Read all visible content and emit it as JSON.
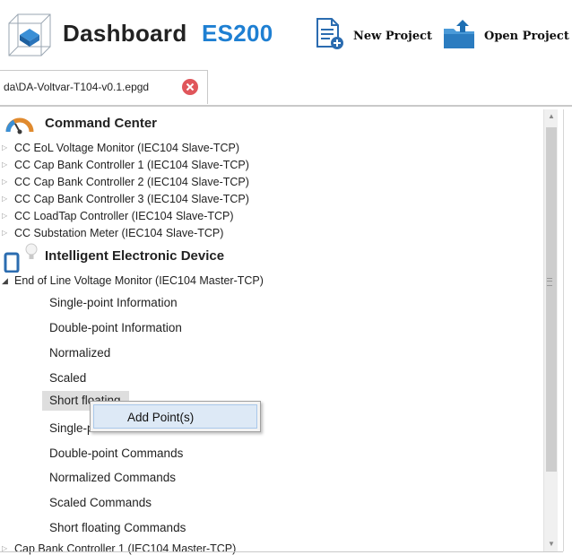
{
  "header": {
    "title": "Dashboard",
    "product": "ES200",
    "new_project_label": "New Project",
    "open_project_label": "Open Project"
  },
  "tab": {
    "label": "da\\DA-Voltvar-T104-v0.1.epgd"
  },
  "command_center": {
    "title": "Command Center",
    "items": [
      "CC EoL Voltage Monitor (IEC104 Slave-TCP)",
      "CC Cap Bank Controller 1 (IEC104 Slave-TCP)",
      "CC Cap Bank Controller 2 (IEC104 Slave-TCP)",
      "CC Cap Bank Controller 3 (IEC104 Slave-TCP)",
      "CC LoadTap Controller (IEC104 Slave-TCP)",
      "CC Substation Meter (IEC104 Slave-TCP)"
    ]
  },
  "ied": {
    "title": "Intelligent Electronic Device",
    "expanded_item": "End of Line Voltage Monitor (IEC104 Master-TCP)",
    "children": [
      "Single-point Information",
      "Double-point Information",
      "Normalized",
      "Scaled",
      "Short floating",
      "Single-point Commands",
      "Double-point Commands",
      "Normalized Commands",
      "Scaled Commands",
      "Short floating Commands"
    ],
    "next_item": "Cap Bank Controller 1 (IEC104 Master-TCP)"
  },
  "context_menu": {
    "add_points_label": "Add Point(s)"
  },
  "icons": {
    "logo": "cube-logo-icon",
    "new_project": "new-document-icon",
    "open_project": "open-folder-icon",
    "tab_close": "close-circle-icon",
    "command_center": "gauge-icon",
    "ied": "device-lightbulb-icon",
    "collapsed": "triangle-right-icon",
    "expanded": "triangle-down-icon"
  },
  "colors": {
    "accent": "#1e7fd2",
    "close": "#e0565b",
    "menu_highlight": "#dde9f6"
  }
}
